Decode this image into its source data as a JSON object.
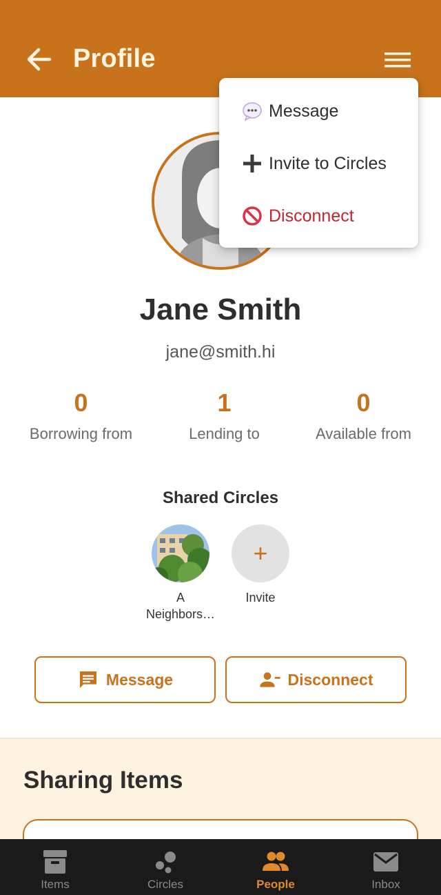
{
  "header": {
    "title": "Profile"
  },
  "profile": {
    "name": "Jane Smith",
    "email": "jane@smith.hi"
  },
  "stats": [
    {
      "value": "0",
      "label": "Borrowing from"
    },
    {
      "value": "1",
      "label": "Lending to"
    },
    {
      "value": "0",
      "label": "Available from"
    }
  ],
  "shared_circles": {
    "title": "Shared Circles",
    "circles": [
      {
        "label_line1": "A",
        "label_line2": "Neighbors…"
      }
    ],
    "invite_label": "Invite",
    "invite_symbol": "+"
  },
  "actions": {
    "message": "Message",
    "disconnect": "Disconnect"
  },
  "sharing": {
    "title": "Sharing Items"
  },
  "menu": {
    "items": [
      {
        "label": "Message",
        "icon": "speech-bubble-icon"
      },
      {
        "label": "Invite to Circles",
        "icon": "plus-icon"
      },
      {
        "label": "Disconnect",
        "icon": "prohibited-icon"
      }
    ]
  },
  "nav": {
    "items": [
      {
        "label": "Items",
        "icon": "archive-box-icon"
      },
      {
        "label": "Circles",
        "icon": "circles-icon"
      },
      {
        "label": "People",
        "icon": "people-icon"
      },
      {
        "label": "Inbox",
        "icon": "mail-icon"
      }
    ],
    "active": "People"
  },
  "colors": {
    "accent": "#c8731b",
    "danger": "#c0272d",
    "nav_bg": "#1a1a1a",
    "section_bg": "#fdf3e0"
  }
}
